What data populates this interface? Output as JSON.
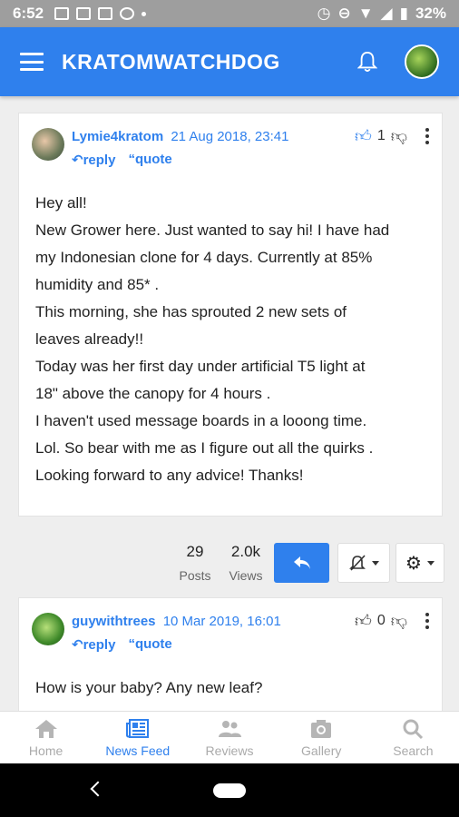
{
  "status_bar": {
    "time": "6:52",
    "battery": "32%"
  },
  "app": {
    "title": "KRATOMWATCHDOG"
  },
  "posts": [
    {
      "username": "Lymie4kratom",
      "date": "21 Aug 2018, 23:41",
      "reply_label": "reply",
      "quote_label": "quote",
      "likes": "1",
      "lines": [
        "Hey all!",
        "New Grower here. Just wanted to say hi! I have had",
        "my Indonesian clone for 4 days. Currently at 85%",
        "humidity and 85* .",
        "This morning, she has sprouted 2 new sets of",
        "leaves already!!",
        "Today was her first day under artificial T5 light at",
        "18\" above the canopy for 4 hours .",
        "I haven't used message boards in a looong time.",
        "Lol. So bear with me as I figure out all the quirks .",
        "Looking forward to any advice! Thanks!"
      ]
    },
    {
      "username": "guywithtrees",
      "date": "10 Mar 2019, 16:01",
      "reply_label": "reply",
      "quote_label": "quote",
      "likes": "0",
      "lines": [
        "How is your baby? Any new leaf?"
      ]
    }
  ],
  "stats": {
    "posts_value": "29",
    "posts_label": "Posts",
    "views_value": "2.0k",
    "views_label": "Views"
  },
  "bottom_nav": [
    {
      "label": "Home",
      "icon": "home-icon"
    },
    {
      "label": "News Feed",
      "icon": "news-feed-icon"
    },
    {
      "label": "Reviews",
      "icon": "reviews-icon"
    },
    {
      "label": "Gallery",
      "icon": "gallery-icon"
    },
    {
      "label": "Search",
      "icon": "search-icon"
    }
  ],
  "colors": {
    "accent": "#2f80ed",
    "status_bar": "#9e9e9e",
    "background": "#eeeeee"
  }
}
